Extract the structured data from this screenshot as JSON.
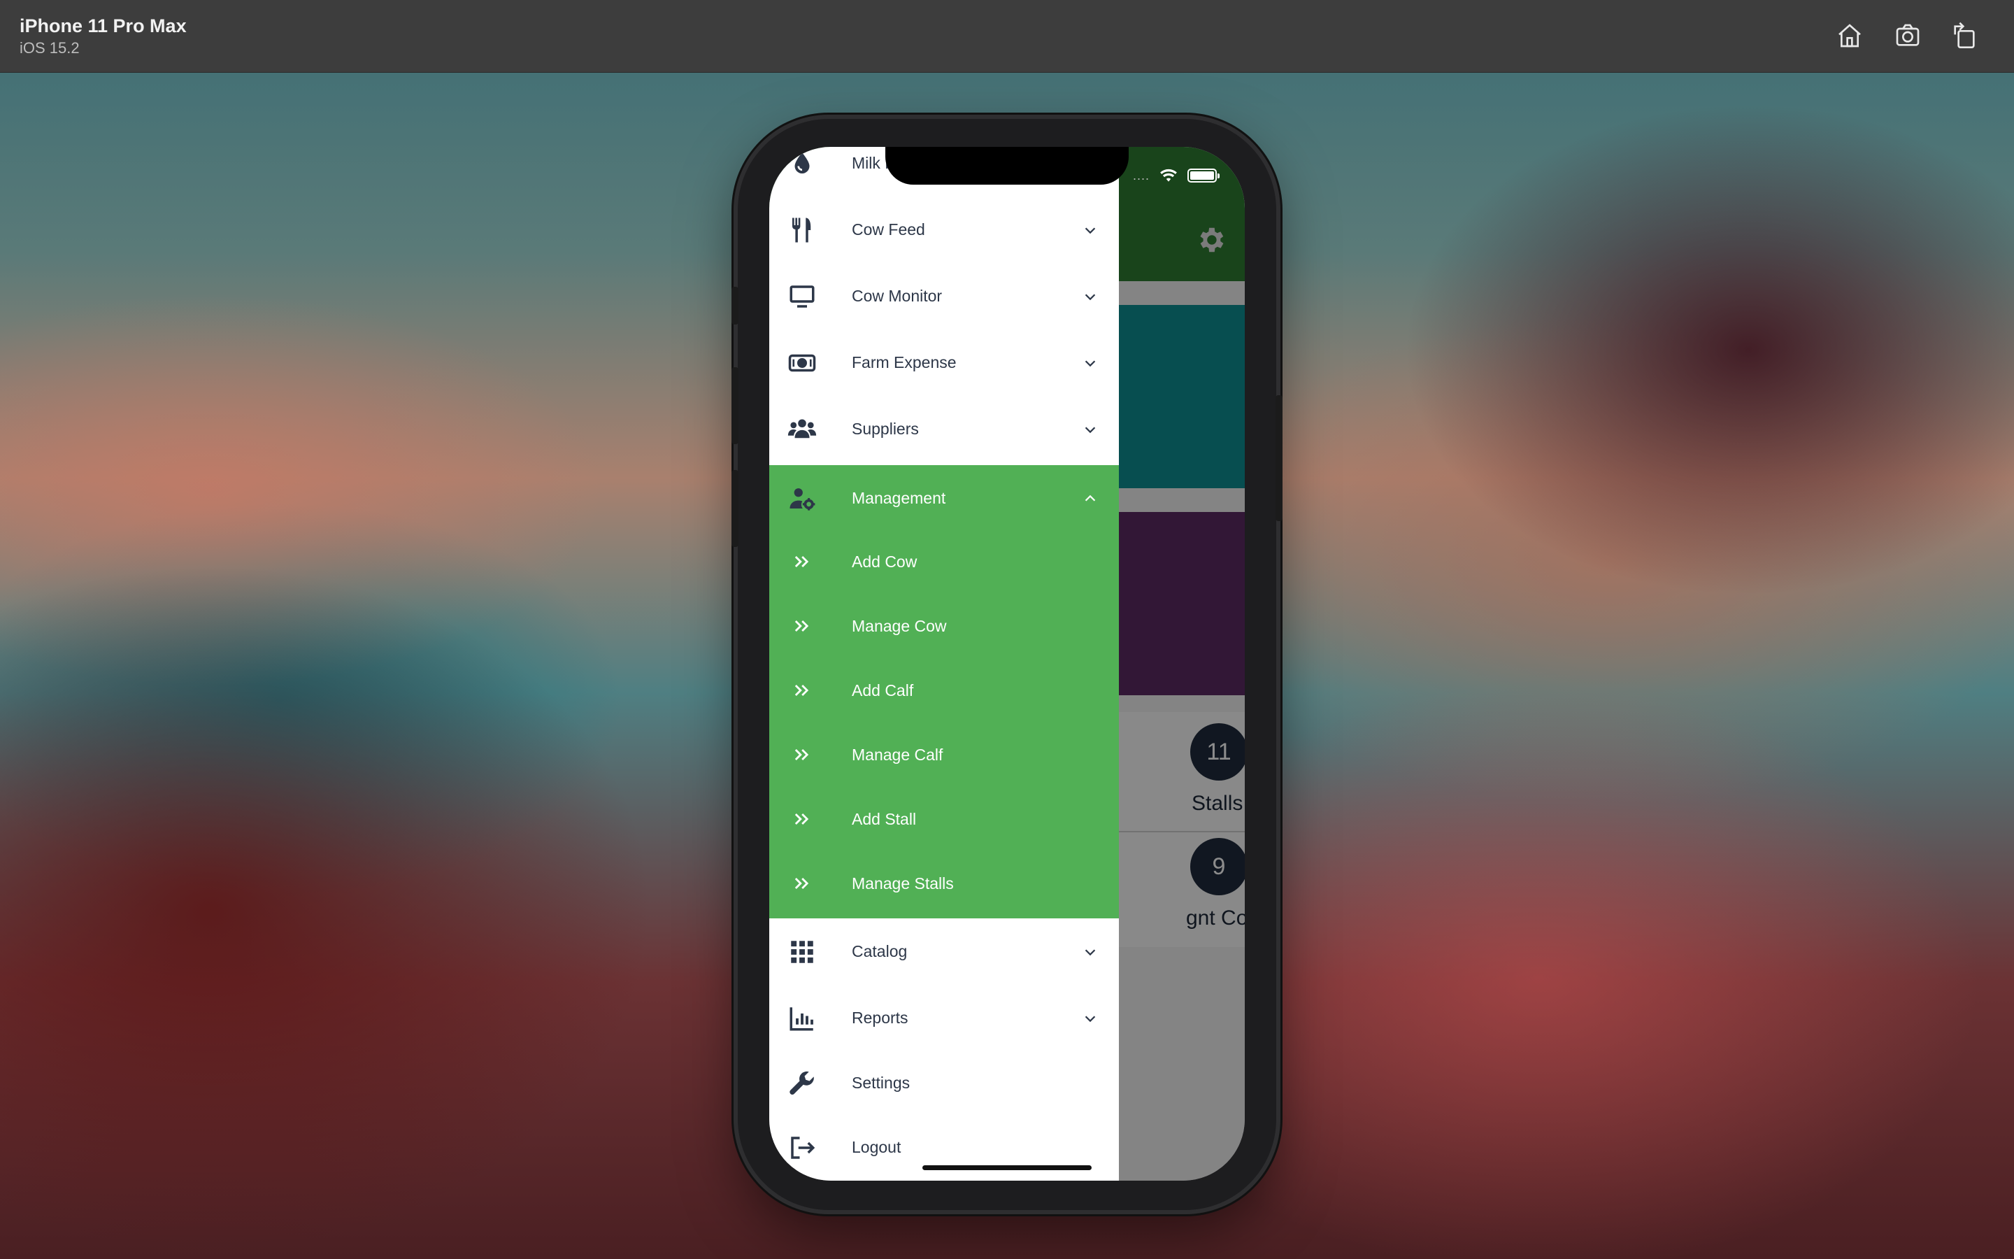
{
  "simulator": {
    "device": "iPhone 11 Pro Max",
    "os": "iOS 15.2",
    "tools": [
      "home-icon",
      "screenshot-icon",
      "rotate-icon"
    ]
  },
  "status_bar": {
    "signal": "....",
    "wifi": "wifi-icon",
    "battery": "battery-icon"
  },
  "drawer": {
    "partial_item": "Milk P",
    "items_top": [
      {
        "label": "Cow Feed",
        "icon": "utensils-icon"
      },
      {
        "label": "Cow Monitor",
        "icon": "monitor-icon"
      },
      {
        "label": "Farm Expense",
        "icon": "money-bill-icon"
      },
      {
        "label": "Suppliers",
        "icon": "users-icon"
      }
    ],
    "management": {
      "label": "Management",
      "icon": "user-cog-icon",
      "expanded": true,
      "subitems": [
        "Add Cow",
        "Manage Cow",
        "Add Calf",
        "Manage Calf",
        "Add Stall",
        "Manage Stalls"
      ]
    },
    "items_bottom": [
      {
        "label": "Catalog",
        "icon": "grid-icon"
      },
      {
        "label": "Reports",
        "icon": "bar-chart-icon"
      },
      {
        "label": "Settings",
        "icon": "wrench-icon"
      },
      {
        "label": "Logout",
        "icon": "logout-icon"
      }
    ]
  },
  "background_app": {
    "stats": [
      {
        "value": "11",
        "label": "Stalls"
      },
      {
        "value": "9",
        "label": "gnt Cows"
      }
    ]
  },
  "colors": {
    "drawer_active": "#51b055",
    "header": "#2e7d32",
    "icon": "#2d3748"
  }
}
